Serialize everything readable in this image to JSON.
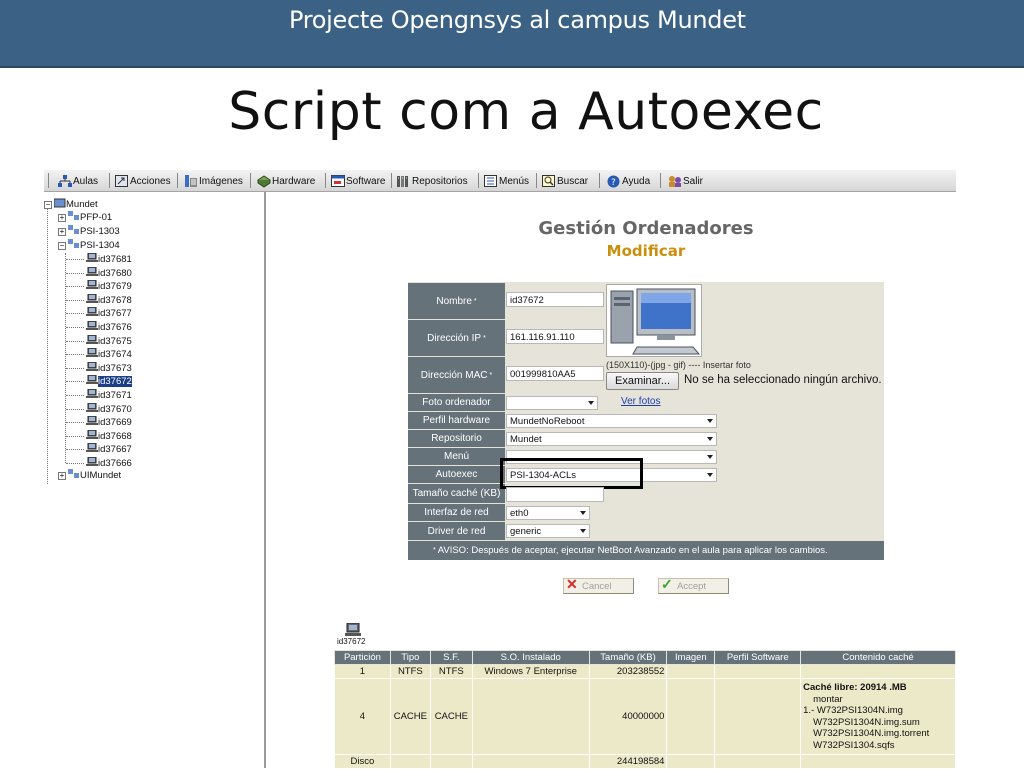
{
  "slide": {
    "header": "Projecte Opengnsys al campus Mundet",
    "title": "Script com a Autoexec"
  },
  "toolbar": {
    "items": [
      "Aulas",
      "Acciones",
      "Imágenes",
      "Hardware",
      "Software",
      "Repositorios",
      "Menús",
      "Buscar",
      "Ayuda",
      "Salir"
    ]
  },
  "tree": {
    "root": "Mundet",
    "groups": [
      "PFP-01",
      "PSI-1303",
      "PSI-1304"
    ],
    "computers": [
      "id37681",
      "id37680",
      "id37679",
      "id37678",
      "id37677",
      "id37676",
      "id37675",
      "id37674",
      "id37673",
      "id37672",
      "id37671",
      "id37670",
      "id37669",
      "id37668",
      "id37667",
      "id37666"
    ],
    "selected": "id37672",
    "last": "UIMundet"
  },
  "form": {
    "title": "Gestión Ordenadores",
    "subtitle": "Modificar",
    "labels": {
      "nombre": "Nombre",
      "ip": "Dirección IP",
      "mac": "Dirección MAC",
      "foto": "Foto ordenador",
      "perfil": "Perfil hardware",
      "repositorio": "Repositorio",
      "menu": "Menú",
      "autoexec": "Autoexec",
      "cache": "Tamaño caché (KB)",
      "interfaz": "Interfaz de red",
      "driver": "Driver de red"
    },
    "required_mark": "*",
    "values": {
      "nombre": "id37672",
      "ip": "161.116.91.110",
      "mac": "001999810AA5",
      "foto": "",
      "perfil": "MundetNoReboot",
      "repositorio": "Mundet",
      "menu": "",
      "autoexec": "PSI-1304-ACLs",
      "cache": "",
      "interfaz": "eth0",
      "driver": "generic"
    },
    "photo_hint": "(150X110)-(jpg - gif) ---- Insertar foto",
    "browse_label": "Examinar...",
    "no_file": "No se ha seleccionado ningún archivo.",
    "ver_fotos": "Ver fotos",
    "warning": "AVISO: Después de aceptar, ejecutar NetBoot Avanzado en el aula para aplicar los cambios.",
    "cancel": "Cancel",
    "accept": "Accept"
  },
  "partitions": {
    "caption": "id37672",
    "headers": [
      "Partición",
      "Tipo",
      "S.F.",
      "S.O. Instalado",
      "Tamaño (KB)",
      "Imagen",
      "Perfil Software",
      "Contenido caché"
    ],
    "rows": [
      {
        "particion": "1",
        "tipo": "NTFS",
        "sf": "NTFS",
        "so": "Windows 7 Enterprise",
        "tamano": "203238552",
        "imagen": "",
        "perfil": "",
        "cache": ""
      },
      {
        "particion": "4",
        "tipo": "CACHE",
        "sf": "CACHE",
        "so": "",
        "tamano": "40000000",
        "imagen": "",
        "perfil": ""
      },
      {
        "particion": "Disco",
        "tipo": "",
        "sf": "",
        "so": "",
        "tamano": "244198584",
        "imagen": "",
        "perfil": "",
        "cache": ""
      }
    ],
    "cache_content": {
      "free": "Caché libre: 20914 .MB",
      "mount": "montar",
      "items": [
        "1.- W732PSI1304N.img",
        "W732PSI1304N.img.sum",
        "W732PSI1304N.img.torrent",
        "W732PSI1304.sqfs"
      ]
    }
  },
  "colors": {
    "header_bg": "#3b6184",
    "label_bg": "#66727a",
    "form_bg": "#e6e3d8",
    "subtitle": "#c8900c",
    "selected_bg": "#1c3e88",
    "table_cell": "#ece9c9"
  }
}
